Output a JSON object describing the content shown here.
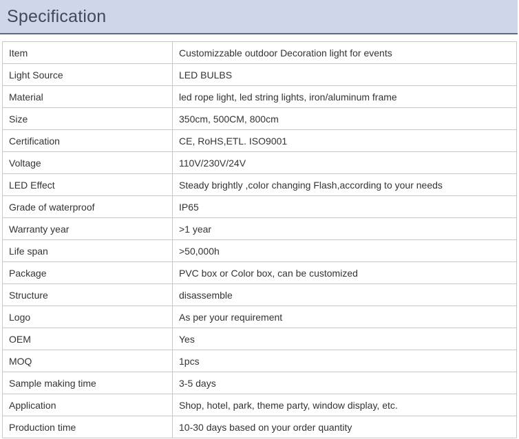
{
  "header": {
    "title": "Specification"
  },
  "rows": [
    {
      "label": "Item",
      "value": "Customizzable outdoor Decoration light for events"
    },
    {
      "label": "Light Source",
      "value": "LED BULBS"
    },
    {
      "label": "Material",
      "value": "led rope light, led string lights, iron/aluminum frame"
    },
    {
      "label": "Size",
      "value": "350cm, 500CM, 800cm"
    },
    {
      "label": "Certification",
      "value": "CE, RoHS,ETL. ISO9001"
    },
    {
      "label": "Voltage",
      "value": "110V/230V/24V"
    },
    {
      "label": "LED Effect",
      "value": "Steady brightly ,color changing Flash,according to your needs"
    },
    {
      "label": "Grade of waterproof",
      "value": "IP65"
    },
    {
      "label": "Warranty year",
      "value": ">1 year"
    },
    {
      "label": "Life span",
      "value": ">50,000h"
    },
    {
      "label": "Package",
      "value": "PVC box or Color box, can be customized"
    },
    {
      "label": "Structure",
      "value": "disassemble"
    },
    {
      "label": "Logo",
      "value": "As per your requirement"
    },
    {
      "label": "OEM",
      "value": "Yes"
    },
    {
      "label": "MOQ",
      "value": "1pcs"
    },
    {
      "label": "Sample making time",
      "value": "3-5 days"
    },
    {
      "label": "Application",
      "value": "Shop, hotel, park, theme party, window display, etc."
    },
    {
      "label": "Production time",
      "value": "10-30 days based on your order quantity"
    }
  ]
}
